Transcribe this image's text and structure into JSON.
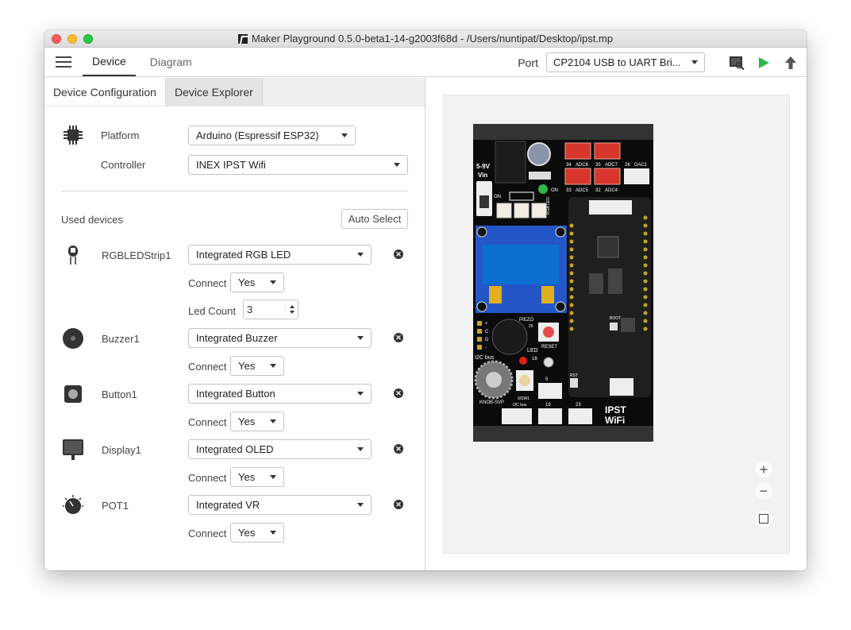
{
  "window": {
    "title": "Maker Playground 0.5.0-beta1-14-g2003f68d - /Users/nuntipat/Desktop/ipst.mp"
  },
  "toolbar": {
    "tabs": [
      {
        "label": "Device",
        "active": true
      },
      {
        "label": "Diagram",
        "active": false
      }
    ],
    "port_label": "Port",
    "port_value": "CP2104 USB to UART Bri..."
  },
  "subtabs": [
    {
      "label": "Device Configuration",
      "active": true
    },
    {
      "label": "Device Explorer",
      "active": false
    }
  ],
  "config": {
    "platform_label": "Platform",
    "platform_value": "Arduino (Espressif ESP32)",
    "controller_label": "Controller",
    "controller_value": "INEX IPST Wifi"
  },
  "used_devices": {
    "heading": "Used devices",
    "auto_select_label": "Auto Select",
    "devices": [
      {
        "name": "RGBLEDStrip1",
        "value": "Integrated RGB LED",
        "connect_label": "Connect",
        "connect_value": "Yes",
        "led_count_label": "Led Count",
        "led_count_value": "3",
        "icon": "led-strip-icon"
      },
      {
        "name": "Buzzer1",
        "value": "Integrated Buzzer",
        "connect_label": "Connect",
        "connect_value": "Yes",
        "icon": "buzzer-icon"
      },
      {
        "name": "Button1",
        "value": "Integrated Button",
        "connect_label": "Connect",
        "connect_value": "Yes",
        "icon": "button-icon"
      },
      {
        "name": "Display1",
        "value": "Integrated OLED",
        "connect_label": "Connect",
        "connect_value": "Yes",
        "icon": "display-icon"
      },
      {
        "name": "POT1",
        "value": "Integrated VR",
        "connect_label": "Connect",
        "connect_value": "Yes",
        "icon": "potentiometer-icon"
      }
    ]
  },
  "board": {
    "power_label": "5-9V",
    "vin_label": "Vin",
    "on_label": "ON",
    "on_led_label": "ON",
    "adc_labels": [
      "34",
      "ADC6",
      "35",
      "ADC7",
      "26",
      "DAC1",
      "33",
      "ADC5",
      "32",
      "ADC4"
    ],
    "rgb_led_label": "RGB LED",
    "piezo_label": "PIEZO",
    "piezo_pin": "25",
    "reset_label": "RESET",
    "led_label": "LED",
    "led_pin": "18",
    "i2c_label": "I2C bus",
    "i2c_label2": "I2C bus",
    "knob_label": "KNOB-SVP",
    "sw1_label": "0/SW1",
    "pin_labels": [
      "5",
      "19",
      "23"
    ],
    "rst_label": "RST",
    "boot_label": "BOOT",
    "brand_line1": "IPST",
    "brand_line2": "WiFi",
    "header_pins": [
      "+",
      "C",
      "D",
      "-"
    ]
  },
  "colors": {
    "accent_green": "#2db84d",
    "board_black": "#111111",
    "connector_red": "#d6362b"
  }
}
